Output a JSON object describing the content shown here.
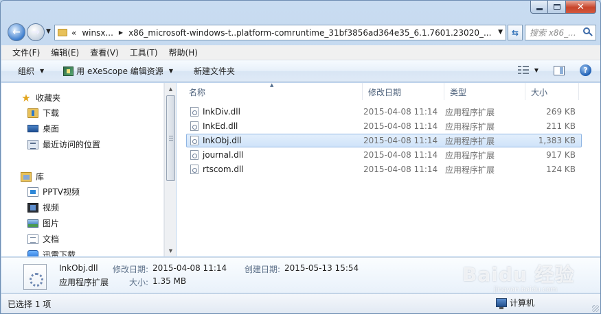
{
  "window": {
    "caption": {
      "minimize": "",
      "maximize": "",
      "close": "✕"
    }
  },
  "address_bar": {
    "overflow": "«",
    "crumbs": [
      "winsx...",
      "x86_microsoft-windows-t..platform-comruntime_31bf3856ad364e35_6.1.7601.23020_..."
    ],
    "search_placeholder": "搜索 x86_..."
  },
  "menu": {
    "items": [
      "文件(F)",
      "编辑(E)",
      "查看(V)",
      "工具(T)",
      "帮助(H)"
    ]
  },
  "command_bar": {
    "organize": "组织",
    "exescope": "用 eXeScope 编辑资源",
    "new_folder": "新建文件夹"
  },
  "nav_pane": {
    "favorites": "收藏夹",
    "downloads": "下载",
    "desktop": "桌面",
    "recent": "最近访问的位置",
    "libraries": "库",
    "pptv": "PPTV视频",
    "videos": "视频",
    "pictures": "图片",
    "documents": "文档",
    "thunder": "迅雷下载"
  },
  "columns": {
    "name": "名称",
    "date": "修改日期",
    "type": "类型",
    "size": "大小"
  },
  "files": [
    {
      "name": "InkDiv.dll",
      "date": "2015-04-08 11:14",
      "type": "应用程序扩展",
      "size": "269 KB",
      "selected": false
    },
    {
      "name": "InkEd.dll",
      "date": "2015-04-08 11:14",
      "type": "应用程序扩展",
      "size": "211 KB",
      "selected": false
    },
    {
      "name": "InkObj.dll",
      "date": "2015-04-08 11:14",
      "type": "应用程序扩展",
      "size": "1,383 KB",
      "selected": true
    },
    {
      "name": "journal.dll",
      "date": "2015-04-08 11:14",
      "type": "应用程序扩展",
      "size": "917 KB",
      "selected": false
    },
    {
      "name": "rtscom.dll",
      "date": "2015-04-08 11:14",
      "type": "应用程序扩展",
      "size": "124 KB",
      "selected": false
    }
  ],
  "details": {
    "filename": "InkObj.dll",
    "filetype": "应用程序扩展",
    "modified_label": "修改日期:",
    "modified_value": "2015-04-08 11:14",
    "created_label": "创建日期:",
    "created_value": "2015-05-13 15:54",
    "size_label": "大小:",
    "size_value": "1.35 MB"
  },
  "status": {
    "selection": "已选择 1 项",
    "computer": "计算机"
  },
  "watermark": {
    "logo": "Baidu 经验",
    "url": "jingyan.baidu.com"
  },
  "colors": {
    "selection_fill": "#cfe3f9",
    "selection_border": "#8fb5e3",
    "frame": "#b9d1ec"
  }
}
